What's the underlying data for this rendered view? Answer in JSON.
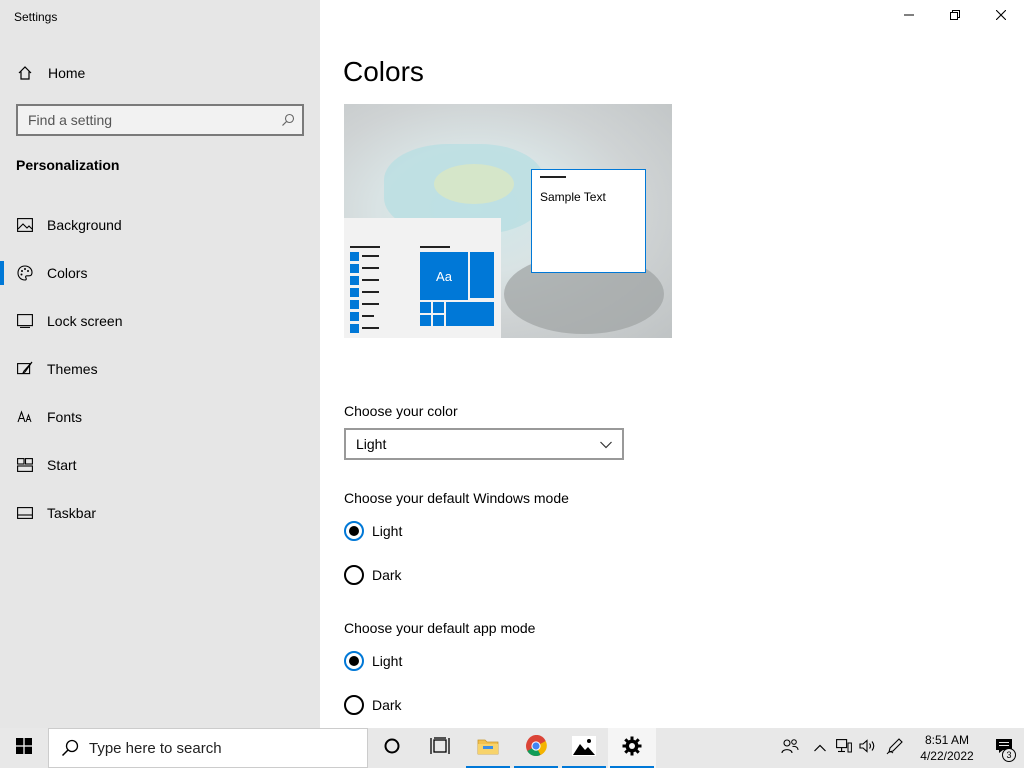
{
  "window": {
    "title": "Settings",
    "controls": {
      "minimize": "minimize-icon",
      "restore": "restore-icon",
      "close": "close-icon"
    }
  },
  "sidebar": {
    "home_label": "Home",
    "search_placeholder": "Find a setting",
    "section_title": "Personalization",
    "items": [
      {
        "label": "Background",
        "icon": "picture-icon",
        "active": false
      },
      {
        "label": "Colors",
        "icon": "palette-icon",
        "active": true
      },
      {
        "label": "Lock screen",
        "icon": "lock-screen-icon",
        "active": false
      },
      {
        "label": "Themes",
        "icon": "brush-icon",
        "active": false
      },
      {
        "label": "Fonts",
        "icon": "fonts-icon",
        "active": false
      },
      {
        "label": "Start",
        "icon": "start-icon",
        "active": false
      },
      {
        "label": "Taskbar",
        "icon": "taskbar-icon",
        "active": false
      }
    ]
  },
  "main": {
    "title": "Colors",
    "preview": {
      "tile_label": "Aa",
      "sample_text": "Sample Text"
    },
    "choose_color_label": "Choose your color",
    "choose_color_value": "Light",
    "windows_mode": {
      "label": "Choose your default Windows mode",
      "options": [
        {
          "label": "Light",
          "checked": true
        },
        {
          "label": "Dark",
          "checked": false
        }
      ]
    },
    "app_mode": {
      "label": "Choose your default app mode",
      "options": [
        {
          "label": "Light",
          "checked": true
        },
        {
          "label": "Dark",
          "checked": false
        }
      ]
    }
  },
  "taskbar": {
    "search_placeholder": "Type here to search",
    "clock_time": "8:51 AM",
    "clock_date": "4/22/2022",
    "notification_count": "3"
  },
  "colors": {
    "accent": "#0078d7",
    "sidebar_bg": "#e6e6e6",
    "taskbar_bg": "#e8e8e8"
  }
}
